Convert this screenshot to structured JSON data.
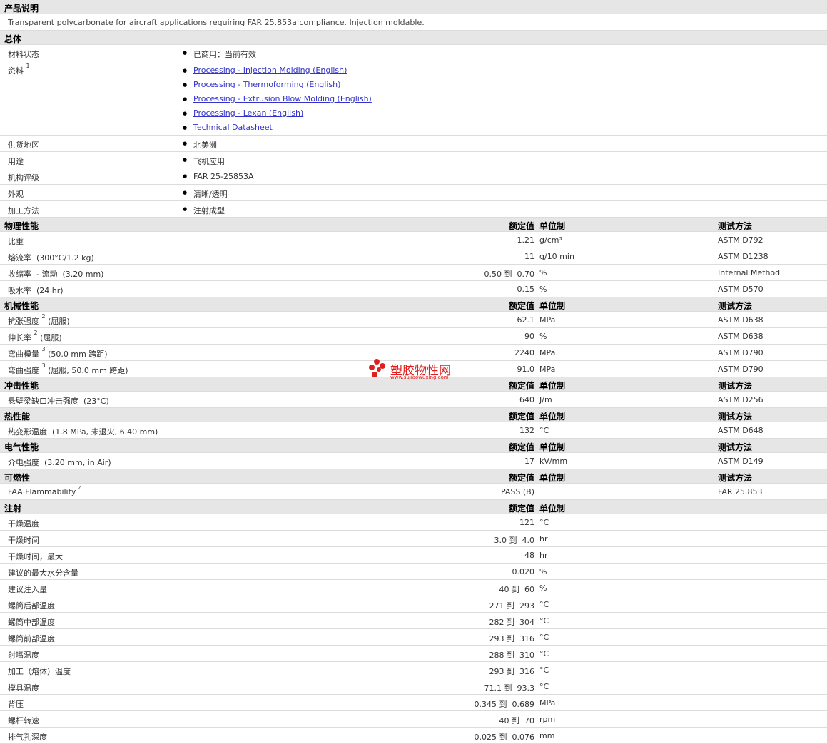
{
  "desc_section": "产品说明",
  "description": "Transparent polycarbonate for aircraft applications requiring FAR 25.853a compliance. Injection moldable.",
  "general": {
    "title": "总体",
    "rows": [
      {
        "label": "材料状态",
        "value": "已商用：当前有效"
      }
    ],
    "literature": {
      "label": "资料",
      "sup": "1",
      "links": [
        "Processing - Injection Molding (English)",
        "Processing - Thermoforming (English)",
        "Processing - Extrusion Blow Molding (English)",
        "Processing - Lexan (English)",
        "Technical Datasheet"
      ]
    },
    "rows2": [
      {
        "label": "供货地区",
        "value": "北美洲"
      },
      {
        "label": "用途",
        "value": "飞机应用"
      },
      {
        "label": "机构评级",
        "value": "FAR 25-25853A"
      },
      {
        "label": "外观",
        "value": "清晰/透明"
      },
      {
        "label": "加工方法",
        "value": "注射成型"
      }
    ]
  },
  "headers": {
    "value": "额定值",
    "unit": "单位制",
    "method": "测试方法"
  },
  "sections": [
    {
      "title": "物理性能",
      "method_header": true,
      "rows": [
        {
          "label": "比重",
          "sup": "",
          "cond": "",
          "value": "1.21",
          "unit": "g/cm³",
          "method": "ASTM D792"
        },
        {
          "label": "熔流率",
          "sup": "",
          "cond": "  (300°C/1.2 kg)",
          "value": "11",
          "unit": "g/10 min",
          "method": "ASTM D1238"
        },
        {
          "label": "收缩率",
          "sup": "",
          "cond": "  - 流动  (3.20 mm)",
          "value": "0.50 到  0.70",
          "unit": "%",
          "method": "Internal Method"
        },
        {
          "label": "吸水率",
          "sup": "",
          "cond": "  (24 hr)",
          "value": "0.15",
          "unit": "%",
          "method": "ASTM D570"
        }
      ]
    },
    {
      "title": "机械性能",
      "method_header": true,
      "rows": [
        {
          "label": "抗张强度",
          "sup": "2",
          "cond": " (屈服)",
          "value": "62.1",
          "unit": "MPa",
          "method": "ASTM D638"
        },
        {
          "label": "伸长率",
          "sup": "2",
          "cond": " (屈服)",
          "value": "90",
          "unit": "%",
          "method": "ASTM D638"
        },
        {
          "label": "弯曲模量",
          "sup": "3",
          "cond": " (50.0 mm 跨距)",
          "value": "2240",
          "unit": "MPa",
          "method": "ASTM D790"
        },
        {
          "label": "弯曲强度",
          "sup": "3",
          "cond": " (屈服, 50.0 mm 跨距)",
          "value": "91.0",
          "unit": "MPa",
          "method": "ASTM D790"
        }
      ]
    },
    {
      "title": "冲击性能",
      "method_header": true,
      "rows": [
        {
          "label": "悬壁梁缺口冲击强度",
          "sup": "",
          "cond": "  (23°C)",
          "value": "640",
          "unit": "J/m",
          "method": "ASTM D256"
        }
      ]
    },
    {
      "title": "热性能",
      "method_header": true,
      "rows": [
        {
          "label": "热变形温度",
          "sup": "",
          "cond": "  (1.8 MPa, 未退火, 6.40 mm)",
          "value": "132",
          "unit": "°C",
          "method": "ASTM D648"
        }
      ]
    },
    {
      "title": "电气性能",
      "method_header": true,
      "rows": [
        {
          "label": "介电强度",
          "sup": "",
          "cond": "  (3.20 mm, in Air)",
          "value": "17",
          "unit": "kV/mm",
          "method": "ASTM D149"
        }
      ]
    },
    {
      "title": "可燃性",
      "method_header": true,
      "rows": [
        {
          "label": "FAA Flammability",
          "sup": "4",
          "cond": "",
          "value": "PASS (B)",
          "unit": "",
          "method": "FAR 25.853"
        }
      ]
    },
    {
      "title": "注射",
      "method_header": false,
      "rows": [
        {
          "label": "干燥温度",
          "sup": "",
          "cond": "",
          "value": "121",
          "unit": "°C",
          "method": ""
        },
        {
          "label": "干燥时间",
          "sup": "",
          "cond": "",
          "value": "3.0 到  4.0",
          "unit": "hr",
          "method": ""
        },
        {
          "label": "干燥时间，最大",
          "sup": "",
          "cond": "",
          "value": "48",
          "unit": "hr",
          "method": ""
        },
        {
          "label": "建议的最大水分含量",
          "sup": "",
          "cond": "",
          "value": "0.020",
          "unit": "%",
          "method": ""
        },
        {
          "label": "建议注入量",
          "sup": "",
          "cond": "",
          "value": "40 到  60",
          "unit": "%",
          "method": ""
        },
        {
          "label": "螺筒后部温度",
          "sup": "",
          "cond": "",
          "value": "271 到  293",
          "unit": "°C",
          "method": ""
        },
        {
          "label": "螺筒中部温度",
          "sup": "",
          "cond": "",
          "value": "282 到  304",
          "unit": "°C",
          "method": ""
        },
        {
          "label": "螺筒前部温度",
          "sup": "",
          "cond": "",
          "value": "293 到  316",
          "unit": "°C",
          "method": ""
        },
        {
          "label": "射嘴温度",
          "sup": "",
          "cond": "",
          "value": "288 到  310",
          "unit": "°C",
          "method": ""
        },
        {
          "label": "加工（熔体）温度",
          "sup": "",
          "cond": "",
          "value": "293 到  316",
          "unit": "°C",
          "method": ""
        },
        {
          "label": "模具温度",
          "sup": "",
          "cond": "",
          "value": "71.1 到  93.3",
          "unit": "°C",
          "method": ""
        },
        {
          "label": "背压",
          "sup": "",
          "cond": "",
          "value": "0.345 到  0.689",
          "unit": "MPa",
          "method": ""
        },
        {
          "label": "螺杆转速",
          "sup": "",
          "cond": "",
          "value": "40 到  70",
          "unit": "rpm",
          "method": ""
        },
        {
          "label": "排气孔深度",
          "sup": "",
          "cond": "",
          "value": "0.025 到  0.076",
          "unit": "mm",
          "method": ""
        }
      ]
    }
  ],
  "watermark": {
    "text": "塑胶物性网",
    "url": "www.sujiaowuxing.com"
  }
}
